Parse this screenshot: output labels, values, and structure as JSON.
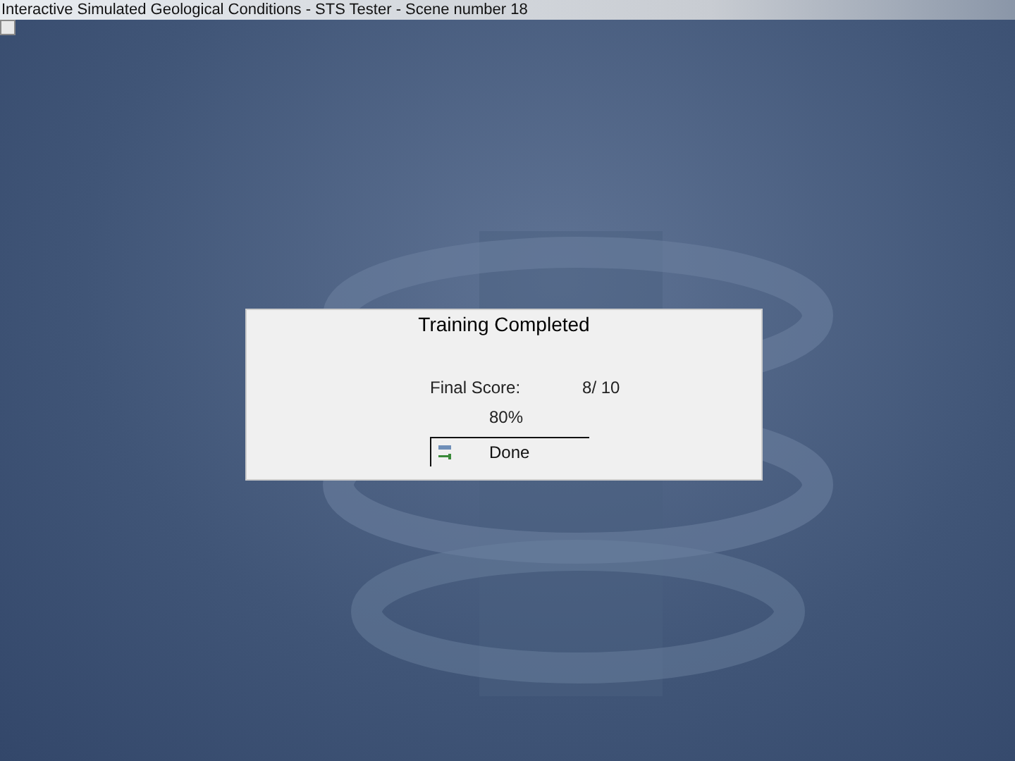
{
  "window": {
    "title": "Interactive Simulated Geological Conditions - STS Tester - Scene number 18"
  },
  "dialog": {
    "title": "Training Completed",
    "score_label": "Final Score:",
    "score_value": "8/ 10",
    "percent": "80%",
    "button": "Done"
  }
}
